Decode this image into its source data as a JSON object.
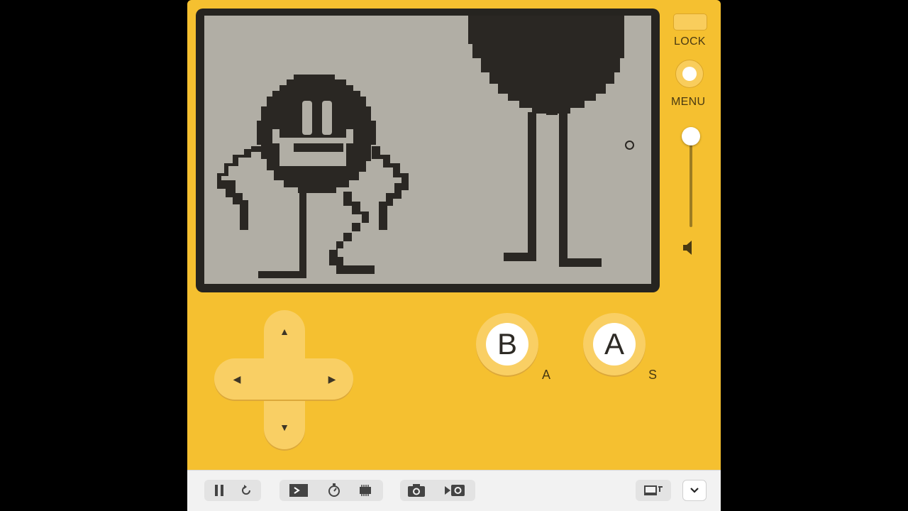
{
  "device": {
    "lock_label": "LOCK",
    "menu_label": "MENU",
    "volume_level": 1.0,
    "colors": {
      "body": "#f5c030",
      "screen": "#b1aea5",
      "pixels": "#2a2723"
    }
  },
  "screen": {
    "scene": "two-pixel-characters",
    "cursor_icon": "crosshair-cursor-icon"
  },
  "controls": {
    "dpad": {
      "up": "▲",
      "down": "▼",
      "left": "◀",
      "right": "▶"
    },
    "b_button": "B",
    "a_button": "A",
    "b_key_hint": "A",
    "a_key_hint": "S"
  },
  "toolbar": {
    "icons": [
      "pause-icon",
      "restart-icon",
      "console-icon",
      "stopwatch-icon",
      "memory-chip-icon",
      "camera-icon",
      "record-video-icon",
      "display-layout-icon",
      "chevron-down-icon"
    ]
  }
}
